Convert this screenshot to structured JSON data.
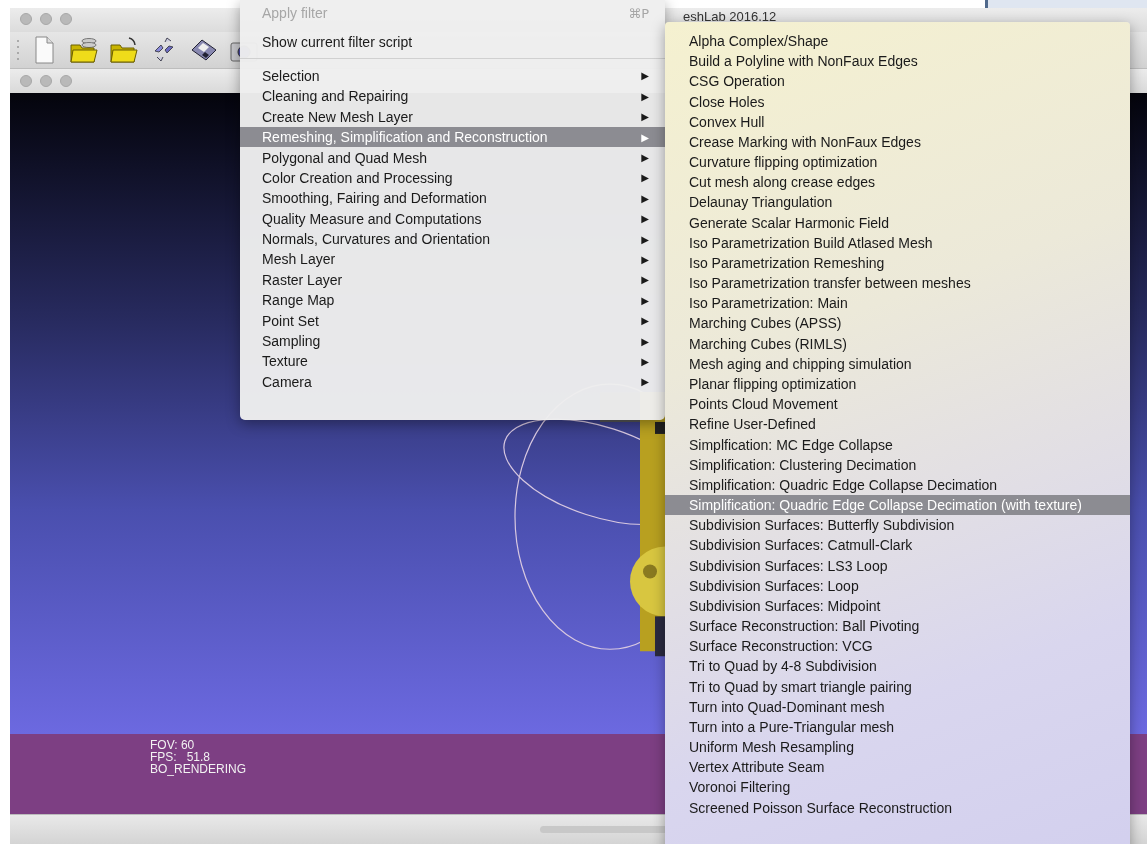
{
  "window": {
    "title": "eshLab 2016.12"
  },
  "viewport": {
    "info_lines": [
      "FOV: 60",
      "FPS:   51.8",
      "BO_RENDERING"
    ]
  },
  "filters_menu": {
    "items": [
      {
        "kind": "command",
        "label": "Apply filter",
        "shortcut": "⌘P",
        "disabled": true
      },
      {
        "kind": "command",
        "label": "Show current filter script",
        "disabled": false
      },
      {
        "kind": "separator"
      },
      {
        "kind": "submenu",
        "label": "Selection",
        "arrow": "▶",
        "selected": false
      },
      {
        "kind": "submenu",
        "label": "Cleaning and Repairing",
        "arrow": "▶",
        "selected": false
      },
      {
        "kind": "submenu",
        "label": "Create New Mesh Layer",
        "arrow": "▶",
        "selected": false
      },
      {
        "kind": "submenu",
        "label": "Remeshing, Simplification and Reconstruction",
        "arrow": "▶",
        "selected": true
      },
      {
        "kind": "submenu",
        "label": "Polygonal and Quad Mesh",
        "arrow": "▶",
        "selected": false
      },
      {
        "kind": "submenu",
        "label": "Color Creation and Processing",
        "arrow": "▶",
        "selected": false
      },
      {
        "kind": "submenu",
        "label": "Smoothing, Fairing and Deformation",
        "arrow": "▶",
        "selected": false
      },
      {
        "kind": "submenu",
        "label": "Quality Measure and Computations",
        "arrow": "▶",
        "selected": false
      },
      {
        "kind": "submenu",
        "label": "Normals, Curvatures and Orientation",
        "arrow": "▶",
        "selected": false
      },
      {
        "kind": "submenu",
        "label": "Mesh Layer",
        "arrow": "▶",
        "selected": false
      },
      {
        "kind": "submenu",
        "label": "Raster Layer",
        "arrow": "▶",
        "selected": false
      },
      {
        "kind": "submenu",
        "label": "Range Map",
        "arrow": "▶",
        "selected": false
      },
      {
        "kind": "submenu",
        "label": "Point Set",
        "arrow": "▶",
        "selected": false
      },
      {
        "kind": "submenu",
        "label": "Sampling",
        "arrow": "▶",
        "selected": false
      },
      {
        "kind": "submenu",
        "label": "Texture",
        "arrow": "▶",
        "selected": false
      },
      {
        "kind": "submenu",
        "label": "Camera",
        "arrow": "▶",
        "selected": false
      }
    ]
  },
  "remeshing_submenu": {
    "items": [
      {
        "label": "Alpha Complex/Shape",
        "selected": false
      },
      {
        "label": "Build a Polyline with NonFaux Edges",
        "selected": false
      },
      {
        "label": "CSG Operation",
        "selected": false
      },
      {
        "label": "Close Holes",
        "selected": false
      },
      {
        "label": "Convex Hull",
        "selected": false
      },
      {
        "label": "Crease Marking with NonFaux Edges",
        "selected": false
      },
      {
        "label": "Curvature flipping optimization",
        "selected": false
      },
      {
        "label": "Cut mesh along crease edges",
        "selected": false
      },
      {
        "label": "Delaunay Triangulation",
        "selected": false
      },
      {
        "label": "Generate Scalar Harmonic Field",
        "selected": false
      },
      {
        "label": "Iso Parametrization Build Atlased Mesh",
        "selected": false
      },
      {
        "label": "Iso Parametrization Remeshing",
        "selected": false
      },
      {
        "label": "Iso Parametrization transfer between meshes",
        "selected": false
      },
      {
        "label": "Iso Parametrization: Main",
        "selected": false
      },
      {
        "label": "Marching Cubes (APSS)",
        "selected": false
      },
      {
        "label": "Marching Cubes (RIMLS)",
        "selected": false
      },
      {
        "label": "Mesh aging and chipping simulation",
        "selected": false
      },
      {
        "label": "Planar flipping optimization",
        "selected": false
      },
      {
        "label": "Points Cloud Movement",
        "selected": false
      },
      {
        "label": "Refine User-Defined",
        "selected": false
      },
      {
        "label": "Simplfication: MC Edge Collapse",
        "selected": false
      },
      {
        "label": "Simplification: Clustering Decimation",
        "selected": false
      },
      {
        "label": "Simplification: Quadric Edge Collapse Decimation",
        "selected": false
      },
      {
        "label": "Simplification: Quadric Edge Collapse Decimation (with texture)",
        "selected": true
      },
      {
        "label": "Subdivision Surfaces: Butterfly Subdivision",
        "selected": false
      },
      {
        "label": "Subdivision Surfaces: Catmull-Clark",
        "selected": false
      },
      {
        "label": "Subdivision Surfaces: LS3 Loop",
        "selected": false
      },
      {
        "label": "Subdivision Surfaces: Loop",
        "selected": false
      },
      {
        "label": "Subdivision Surfaces: Midpoint",
        "selected": false
      },
      {
        "label": "Surface Reconstruction: Ball Pivoting",
        "selected": false
      },
      {
        "label": "Surface Reconstruction: VCG",
        "selected": false
      },
      {
        "label": "Tri to Quad by 4-8 Subdivision",
        "selected": false
      },
      {
        "label": "Tri to Quad by smart triangle pairing",
        "selected": false
      },
      {
        "label": "Turn into Quad-Dominant mesh",
        "selected": false
      },
      {
        "label": "Turn into a Pure-Triangular mesh",
        "selected": false
      },
      {
        "label": "Uniform Mesh Resampling",
        "selected": false
      },
      {
        "label": "Vertex Attribute Seam",
        "selected": false
      },
      {
        "label": "Voronoi Filtering",
        "selected": false
      },
      {
        "label": "Screened Poisson Surface Reconstruction",
        "selected": false
      }
    ]
  }
}
